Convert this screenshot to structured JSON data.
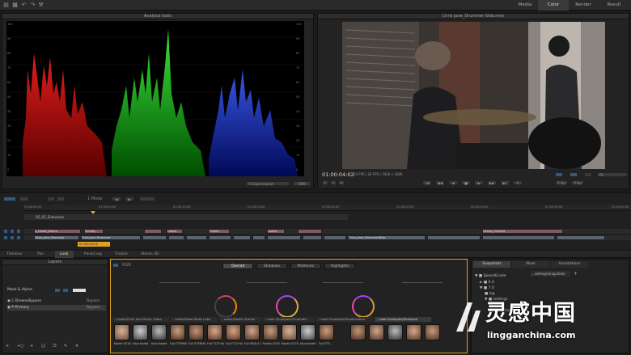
{
  "workspace_tabs": [
    {
      "label": "Media",
      "active": false
    },
    {
      "label": "Color",
      "active": true
    },
    {
      "label": "Render",
      "active": false
    },
    {
      "label": "Result",
      "active": false
    }
  ],
  "scopes": {
    "title": "Analysis tools",
    "layout_select": "1 Scope Layout",
    "scale_select": "1080",
    "left_ticks": [
      "100",
      "90",
      "80",
      "70",
      "60",
      "50",
      "40",
      "30",
      "20",
      "10",
      "0"
    ],
    "right_ticks": [
      "100",
      "90",
      "80",
      "70",
      "60",
      "50",
      "40",
      "30",
      "20",
      "10",
      "0"
    ]
  },
  "viewer": {
    "title": "Chris Jane_Drummer Side.mov",
    "timecode": "01:00:04:02",
    "info": "24 FPS  |  24 FPS  |  1920 x 1080",
    "fit_select": "Fit",
    "layout_buttons": [
      "1 Up",
      "2 Up"
    ]
  },
  "timeline": {
    "head_ticks": [
      "01:00:00:00",
      "01:00:05:00",
      "01:00:10:00",
      "01:00:15:00",
      "01:00:20:00",
      "01:00:25:00",
      "01:00:30:00",
      "01:00:35:00",
      "01:00:40:00"
    ],
    "track_title": "DS_02_Sidewinds",
    "playhead_tc": "01:00:04:02",
    "mode_label": "1 Mode",
    "clips_top": [
      "a_Grade_Hanna",
      "Sunday",
      "",
      "Lookie",
      "Gradie",
      "Lookie",
      "",
      "",
      "",
      "Hanna_Grading"
    ],
    "clips_bottom": [
      "Chris_Jane_Drummer",
      "Chris Jane Drummer",
      "",
      "",
      "",
      "",
      "",
      "",
      "",
      "",
      "",
      "Chris_Jane_DrummerWide",
      "",
      ""
    ]
  },
  "bottom_tabs": [
    {
      "label": "Timeline",
      "active": false
    },
    {
      "label": "Pan",
      "active": false
    },
    {
      "label": "Look",
      "active": true
    },
    {
      "label": "Pan&Crop",
      "active": false
    },
    {
      "label": "Tracker",
      "active": false
    },
    {
      "label": "Stereo 3D",
      "active": false
    }
  ],
  "layers": {
    "title": "Layers",
    "mask_label": "Mask & Alpha",
    "rows": [
      {
        "label": "C  BrowseBypass",
        "right": "Bypass"
      },
      {
        "label": "P  Primary",
        "right": "Bypass"
      }
    ]
  },
  "grade": {
    "tabs": [
      {
        "label": "Overall",
        "active": true
      },
      {
        "label": "Shadows",
        "active": false
      },
      {
        "label": "Midtones",
        "active": false
      },
      {
        "label": "Highlights",
        "active": false
      }
    ],
    "mode_buttons": [
      "LMS",
      "RGB"
    ],
    "look_tabs": [
      "...Looks/Chris Jane Music Video",
      "...Looks/Dawn/Rues Labs",
      "...Looks/Death Scenes",
      "...Look Examples/Cinematic",
      "...Look Examples/Desaturation",
      "...Look Examples/Filmstock"
    ],
    "thumb_labels": [
      "Kodak 5218...",
      "b&w Kodak 5...",
      "b&w Kodak 5...",
      "Fuji ETERNA...",
      "Fuji ETERNA...",
      "Fuji F125 Kod...",
      "Fuji F125 Kod...",
      "Fuji REALA 5...",
      "Kodak 5205 F...",
      "Kodak 5218...",
      "b&w Kodak 5...",
      "Fuji ETE..."
    ]
  },
  "snapshots": {
    "tabs": [
      {
        "label": "Snapshots",
        "active": true
      },
      {
        "label": "Mask",
        "active": false
      },
      {
        "label": "Annotations",
        "active": false
      }
    ],
    "tree": [
      "SpeedGrade",
      "6.4",
      "7.0",
      "log",
      "settings",
      "views",
      "snapshots"
    ],
    "folder_tab": "...settings/snapshots"
  },
  "watermark": {
    "cn": "灵感中国",
    "url": "lingganchina.com"
  },
  "colors": {
    "accent_orange": "#e0a020",
    "selection_blue": "#2f5a86",
    "clip_pink": "#7e5a66",
    "clip_gray": "#5a6470"
  }
}
